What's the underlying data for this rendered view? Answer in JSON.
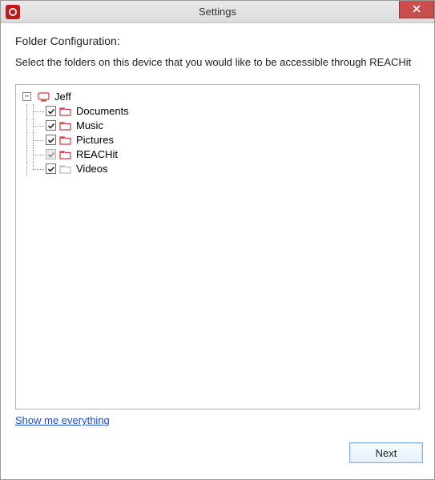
{
  "window": {
    "title": "Settings",
    "close_tooltip": "Close"
  },
  "page": {
    "heading": "Folder Configuration:",
    "subtext": "Select the folders on this device that you would like to be accessible through REACHit",
    "show_everything": "Show me everything"
  },
  "tree": {
    "root": {
      "label": "Jeff",
      "expanded": true,
      "icon": "computer"
    },
    "items": [
      {
        "label": "Documents",
        "checked": true,
        "enabled": true,
        "icon": "folder-red"
      },
      {
        "label": "Music",
        "checked": true,
        "enabled": true,
        "icon": "folder-red"
      },
      {
        "label": "Pictures",
        "checked": true,
        "enabled": true,
        "icon": "folder-red"
      },
      {
        "label": "REACHit",
        "checked": true,
        "enabled": false,
        "icon": "folder-red"
      },
      {
        "label": "Videos",
        "checked": true,
        "enabled": true,
        "icon": "folder-grey"
      }
    ]
  },
  "footer": {
    "next": "Next"
  },
  "colors": {
    "close_bg": "#c94f4f",
    "link": "#1a4fcf",
    "folder_red": "#d23a3a",
    "folder_grey": "#bdbdbd"
  }
}
